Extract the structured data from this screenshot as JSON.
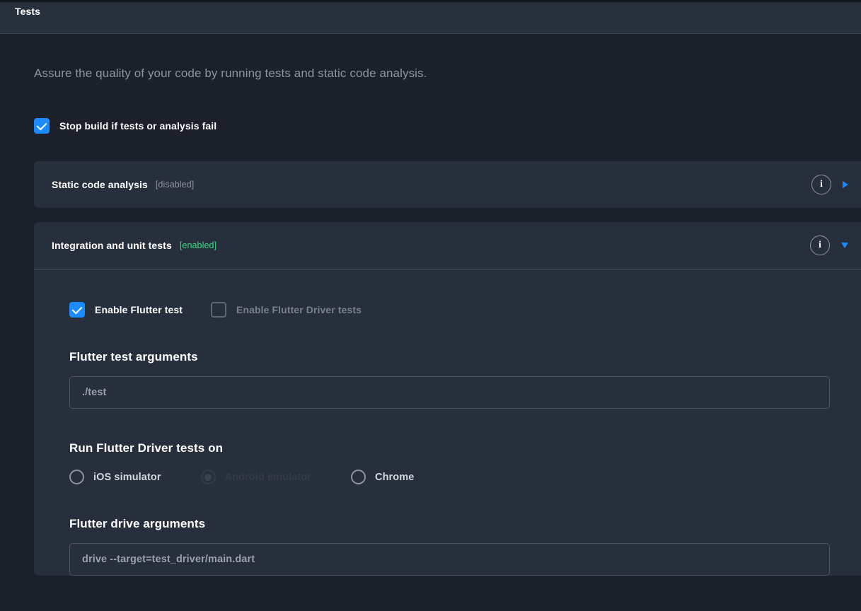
{
  "header": {
    "title": "Tests"
  },
  "page": {
    "description": "Assure the quality of your code by running tests and static code analysis.",
    "stop_build": {
      "label": "Stop build if tests or analysis fail",
      "checked": true
    }
  },
  "sections": [
    {
      "title": "Static code analysis",
      "state": "[disabled]",
      "state_kind": "disabled",
      "expanded": false,
      "info_icon": "info-icon",
      "arrow_icon": "chevron-right-icon"
    },
    {
      "title": "Integration and unit tests",
      "state": "[enabled]",
      "state_kind": "enabled",
      "expanded": true,
      "info_icon": "info-icon",
      "arrow_icon": "chevron-down-icon"
    }
  ],
  "integration_body": {
    "checkboxes": [
      {
        "label": "Enable Flutter test",
        "checked": true,
        "disabled": false
      },
      {
        "label": "Enable Flutter Driver tests",
        "checked": false,
        "disabled": true
      }
    ],
    "flutter_test_arguments": {
      "label": "Flutter test arguments",
      "value": "./test"
    },
    "run_driver_tests_on": {
      "label": "Run Flutter Driver tests on",
      "options": [
        {
          "label": "iOS simulator",
          "selected": false,
          "disabled": false
        },
        {
          "label": "Android emulator",
          "selected": true,
          "disabled": true
        },
        {
          "label": "Chrome",
          "selected": false,
          "disabled": false
        }
      ]
    },
    "flutter_drive_arguments": {
      "label": "Flutter drive arguments",
      "value": "drive --target=test_driver/main.dart"
    }
  },
  "colors": {
    "accent_blue": "#1a8cff",
    "enabled_green": "#3ddc84",
    "page_bg": "#1b202a",
    "card_bg": "#272e3c",
    "header_bg": "#282f3d"
  }
}
